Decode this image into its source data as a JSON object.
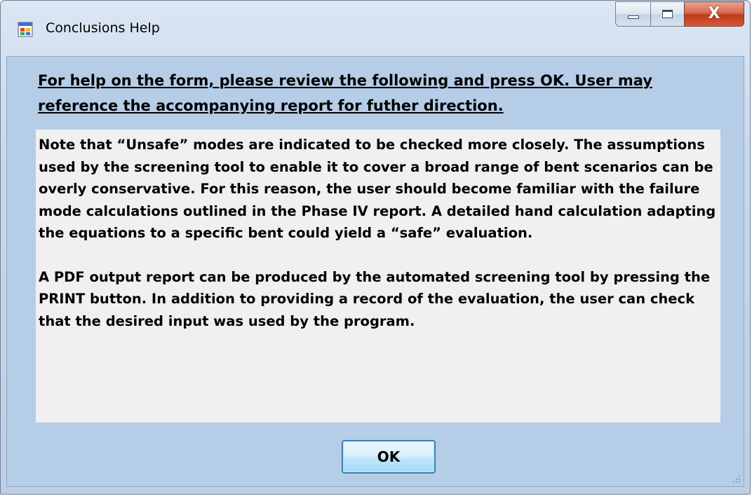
{
  "window": {
    "title": "Conclusions Help",
    "icon": "form-icon",
    "caption_buttons": {
      "minimize_icon": "minimize-icon",
      "maximize_icon": "maximize-icon",
      "close_icon": "close-icon",
      "close_label": "X"
    }
  },
  "help": {
    "heading": "For help on the form, please review the following and press OK.  User may reference the accompanying report for futher direction.",
    "paragraphs": [
      "Note that “Unsafe” modes are indicated to be checked more closely.  The assumptions used by the screening tool to enable it to cover a broad range of bent scenarios can be overly conservative.  For this reason, the user should become familiar with the failure mode calculations outlined in the Phase IV report.  A detailed hand calculation adapting the equations to a specific bent could yield a “safe” evaluation.",
      "A PDF output report can be produced by the automated screening tool by pressing the PRINT button.  In addition to providing a record of the evaluation, the user can check that the desired input was used by the program."
    ]
  },
  "buttons": {
    "ok_label": "OK"
  },
  "colors": {
    "client_background": "#b6cde7",
    "text_area_background": "#f0f0f0",
    "close_button": "#c0391b"
  }
}
